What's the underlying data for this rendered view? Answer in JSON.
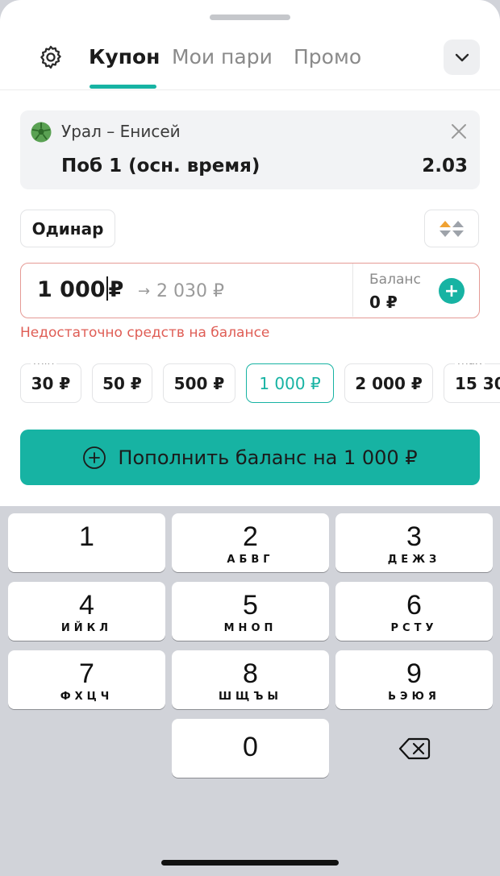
{
  "tabs": [
    {
      "label": "Купон",
      "active": true
    },
    {
      "label": "Мои пари",
      "active": false
    },
    {
      "label": "Промо",
      "active": false
    }
  ],
  "icons": {
    "settings": "gear-icon",
    "collapse": "chevron-down-icon",
    "sport": "football-icon",
    "remove": "close-icon",
    "sort": "sort-arrows-icon",
    "add_balance": "plus-icon",
    "topup": "plus-circle-icon",
    "backspace": "backspace-icon"
  },
  "event": {
    "match": "Урал – Енисей",
    "outcome": "Поб 1 (осн. время)",
    "odds": "2.03"
  },
  "bet_type": "Одинар",
  "stake": {
    "amount": "1 000",
    "currency": "₽",
    "arrow": "→",
    "potential_win": "2 030 ₽",
    "balance_label": "Баланс",
    "balance_value": "0 ₽",
    "add_label": "+"
  },
  "error": "Недостаточно средств на балансе",
  "quick_amounts": [
    {
      "label": "30 ₽",
      "tag": "min"
    },
    {
      "label": "50 ₽"
    },
    {
      "label": "500 ₽"
    },
    {
      "label": "1 000 ₽",
      "selected": true
    },
    {
      "label": "2 000 ₽"
    },
    {
      "label": "15 30",
      "tag": "max"
    }
  ],
  "topup_button": "Пополнить баланс на 1 000 ₽",
  "keyboard": {
    "keys": [
      {
        "digit": "1",
        "letters": ""
      },
      {
        "digit": "2",
        "letters": "АБВГ"
      },
      {
        "digit": "3",
        "letters": "ДЕЖЗ"
      },
      {
        "digit": "4",
        "letters": "ИЙКЛ"
      },
      {
        "digit": "5",
        "letters": "МНОП"
      },
      {
        "digit": "6",
        "letters": "РСТУ"
      },
      {
        "digit": "7",
        "letters": "ФХЦЧ"
      },
      {
        "digit": "8",
        "letters": "ШЩЪЫ"
      },
      {
        "digit": "9",
        "letters": "ЬЭЮЯ"
      },
      {
        "digit": "0",
        "letters": ""
      }
    ]
  },
  "colors": {
    "accent": "#17b3a3",
    "error": "#df5d55",
    "error_border": "#e59a95",
    "card_bg": "#f2f3f5",
    "keyboard_bg": "#d1d3d9",
    "sort_up": "#f0a232",
    "sort_down": "#9ea3aa"
  }
}
